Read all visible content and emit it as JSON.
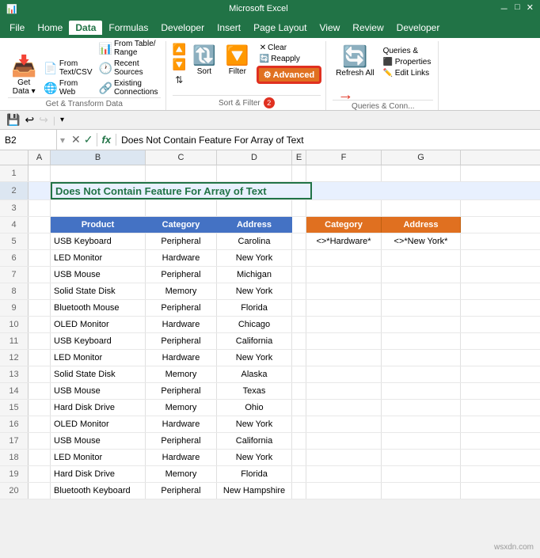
{
  "title": "Microsoft Excel",
  "menu": {
    "items": [
      "File",
      "Home",
      "Data",
      "Formulas",
      "Developer",
      "Insert",
      "Page Layout",
      "View",
      "Review",
      "Developer"
    ]
  },
  "ribbon": {
    "groups": [
      {
        "label": "Get & Transform Data",
        "buttons": [
          {
            "label": "Get\nData",
            "icon": "📥"
          },
          {
            "label": "From\nText/CSV",
            "icon": "📄"
          },
          {
            "label": "From\nWeb",
            "icon": "🌐"
          },
          {
            "label": "From Table/\nRange",
            "icon": "📊"
          },
          {
            "label": "Recent\nSources",
            "icon": "🕐"
          },
          {
            "label": "Existing\nConnections",
            "icon": "🔗"
          }
        ]
      },
      {
        "label": "Sort & Filter",
        "buttons": [
          {
            "label": "Sort",
            "icon": "🔃"
          },
          {
            "label": "Filter",
            "icon": "🔽"
          },
          {
            "label": "Advanced",
            "icon": "⚙"
          }
        ]
      },
      {
        "label": "Queries & Conn...",
        "buttons": [
          {
            "label": "Refresh\nAll",
            "icon": "🔄"
          },
          {
            "label": "Queries &\nConnect...",
            "icon": "🔌"
          },
          {
            "label": "Properties",
            "icon": "📋"
          },
          {
            "label": "Edit Links",
            "icon": "🔗"
          }
        ]
      }
    ]
  },
  "formula_bar": {
    "name_box": "B2",
    "formula": "Does Not Contain Feature For Array of Text"
  },
  "columns": {
    "headers": [
      "A",
      "B",
      "C",
      "D",
      "E",
      "F",
      "G"
    ]
  },
  "title_text": "Does Not Contain Feature For Array of Text",
  "table_headers": {
    "product": "Product",
    "category": "Category",
    "address": "Address"
  },
  "filter_headers": {
    "category": "Category",
    "address": "Address",
    "cat_value": "<>*Hardware*",
    "addr_value": "<>*New York*"
  },
  "rows": [
    {
      "num": 5,
      "product": "USB Keyboard",
      "category": "Peripheral",
      "address": "Carolina"
    },
    {
      "num": 6,
      "product": "LED Monitor",
      "category": "Hardware",
      "address": "New York"
    },
    {
      "num": 7,
      "product": "USB Mouse",
      "category": "Peripheral",
      "address": "Michigan"
    },
    {
      "num": 8,
      "product": "Solid State Disk",
      "category": "Memory",
      "address": "New York"
    },
    {
      "num": 9,
      "product": "Bluetooth Mouse",
      "category": "Peripheral",
      "address": "Florida"
    },
    {
      "num": 10,
      "product": "OLED Monitor",
      "category": "Hardware",
      "address": "Chicago"
    },
    {
      "num": 11,
      "product": "USB Keyboard",
      "category": "Peripheral",
      "address": "California"
    },
    {
      "num": 12,
      "product": "LED Monitor",
      "category": "Hardware",
      "address": "New York"
    },
    {
      "num": 13,
      "product": "Solid State Disk",
      "category": "Memory",
      "address": "Alaska"
    },
    {
      "num": 14,
      "product": "USB Mouse",
      "category": "Peripheral",
      "address": "Texas"
    },
    {
      "num": 15,
      "product": "Hard Disk Drive",
      "category": "Memory",
      "address": "Ohio"
    },
    {
      "num": 16,
      "product": "OLED Monitor",
      "category": "Hardware",
      "address": "New York"
    },
    {
      "num": 17,
      "product": "USB Mouse",
      "category": "Peripheral",
      "address": "California"
    },
    {
      "num": 18,
      "product": "LED Monitor",
      "category": "Hardware",
      "address": "New York"
    },
    {
      "num": 19,
      "product": "Hard Disk Drive",
      "category": "Memory",
      "address": "Florida"
    },
    {
      "num": 20,
      "product": "Bluetooth Keyboard",
      "category": "Peripheral",
      "address": "New Hampshire"
    }
  ],
  "buttons": {
    "refresh": "Refresh\nAll",
    "advanced": "Advanced",
    "sort": "Sort",
    "filter": "Filter"
  },
  "watermark": "wsxdn.com"
}
